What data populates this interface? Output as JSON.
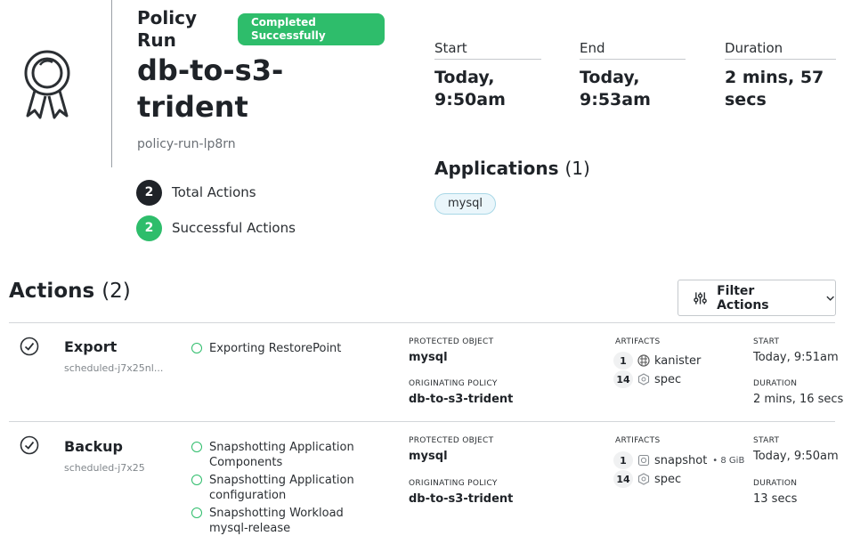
{
  "header": {
    "title": "Policy Run",
    "status": "Completed Successfully",
    "policy_name": "db-to-s3-trident",
    "run_id": "policy-run-lp8rn",
    "counts": [
      {
        "value": "2",
        "label": "Total Actions",
        "color": "#1f2328"
      },
      {
        "value": "2",
        "label": "Successful Actions",
        "color": "#2ebd6b"
      }
    ]
  },
  "stats": [
    {
      "label": "Start",
      "value": "Today, 9:50am"
    },
    {
      "label": "End",
      "value": "Today, 9:53am"
    },
    {
      "label": "Duration",
      "value": "2 mins, 57 secs"
    }
  ],
  "applications": {
    "title": "Applications",
    "count": "(1)",
    "items": [
      "mysql"
    ]
  },
  "actions": {
    "title": "Actions",
    "count": "(2)",
    "filter_label": "Filter Actions",
    "labels": {
      "protected_object": "PROTECTED OBJECT",
      "originating_policy": "ORIGINATING POLICY",
      "artifacts": "ARTIFACTS",
      "start": "START",
      "duration": "DURATION"
    },
    "rows": [
      {
        "name": "Export",
        "sub": "scheduled-j7x25nl...",
        "steps": [
          "Exporting RestorePoint"
        ],
        "protected_object": "mysql",
        "originating_policy": "db-to-s3-trident",
        "artifacts": [
          {
            "count": "1",
            "icon": "kanister-icon",
            "name": "kanister",
            "size": ""
          },
          {
            "count": "14",
            "icon": "kubernetes-spec-icon",
            "name": "spec",
            "size": ""
          }
        ],
        "start": "Today, 9:51am",
        "duration": "2 mins, 16 secs"
      },
      {
        "name": "Backup",
        "sub": "scheduled-j7x25",
        "steps": [
          "Snapshotting Application Components",
          "Snapshotting Application configuration",
          "Snapshotting Workload mysql-release"
        ],
        "protected_object": "mysql",
        "originating_policy": "db-to-s3-trident",
        "artifacts": [
          {
            "count": "1",
            "icon": "snapshot-icon",
            "name": "snapshot",
            "size": "• 8 GiB"
          },
          {
            "count": "14",
            "icon": "kubernetes-spec-icon",
            "name": "spec",
            "size": ""
          }
        ],
        "start": "Today, 9:50am",
        "duration": "13 secs"
      }
    ]
  }
}
